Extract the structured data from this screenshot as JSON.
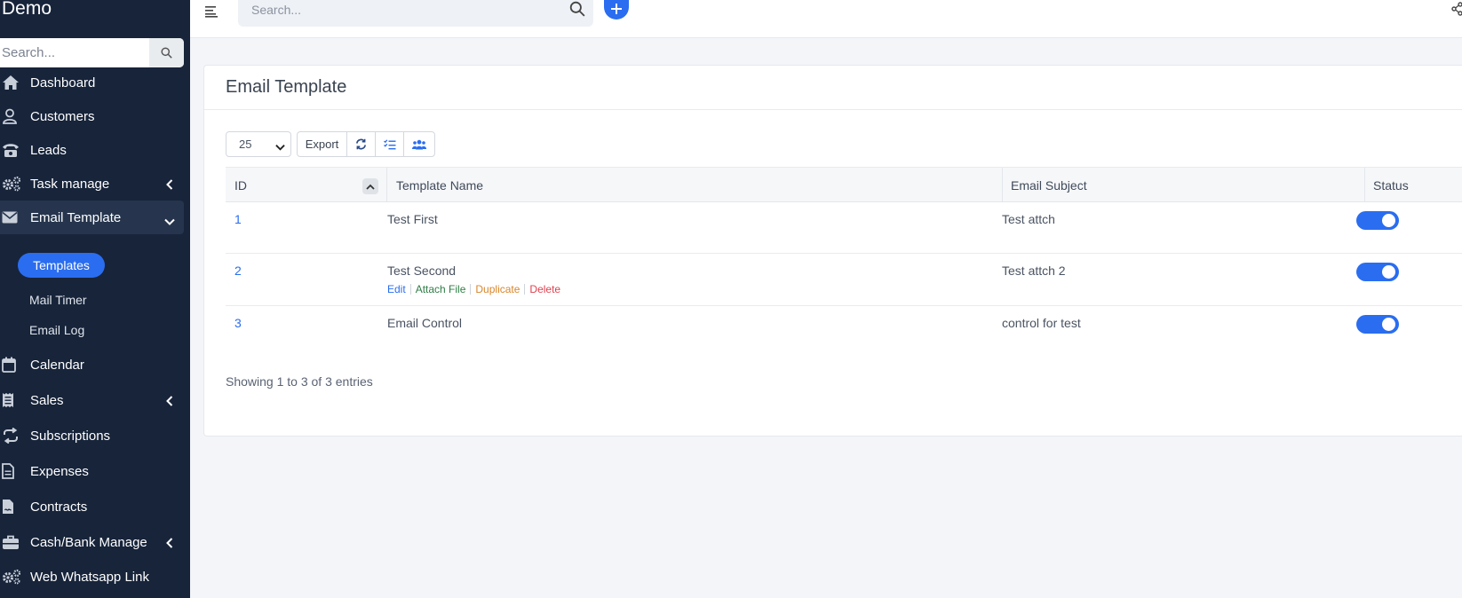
{
  "app": {
    "brand": "Demo"
  },
  "sidebar": {
    "search_placeholder": "Search...",
    "items": [
      {
        "label": "Dashboard",
        "icon": "home-icon"
      },
      {
        "label": "Customers",
        "icon": "user-icon"
      },
      {
        "label": "Leads",
        "icon": "phone-icon"
      },
      {
        "label": "Task manage",
        "icon": "gears-icon"
      },
      {
        "label": "Email Template",
        "icon": "envelope-icon"
      },
      {
        "label": "Calendar",
        "icon": "calendar-icon"
      },
      {
        "label": "Sales",
        "icon": "receipt-icon"
      },
      {
        "label": "Subscriptions",
        "icon": "repeat-icon"
      },
      {
        "label": "Expenses",
        "icon": "file-icon"
      },
      {
        "label": "Contracts",
        "icon": "contract-icon"
      },
      {
        "label": "Cash/Bank Manage",
        "icon": "briefcase-icon"
      },
      {
        "label": "Web Whatsapp Link",
        "icon": "gears-icon"
      }
    ],
    "sub_items": [
      {
        "label": "Templates"
      },
      {
        "label": "Mail Timer"
      },
      {
        "label": "Email Log"
      }
    ]
  },
  "topbar": {
    "search_placeholder": "Search..."
  },
  "page": {
    "title": "Email Template",
    "page_size": "25",
    "export_label": "Export",
    "columns": [
      "ID",
      "Template Name",
      "Email Subject",
      "Status"
    ],
    "rows": [
      {
        "id": "1",
        "name": "Test First",
        "subject": "Test attch",
        "status": "on"
      },
      {
        "id": "2",
        "name": "Test Second",
        "subject": "Test attch 2",
        "status": "on"
      },
      {
        "id": "3",
        "name": "Email Control",
        "subject": "control for test",
        "status": "on"
      }
    ],
    "row_actions": [
      "Edit",
      "Attach File",
      "Duplicate",
      "Delete"
    ],
    "footer": "Showing 1 to 3 of 3 entries"
  },
  "colors": {
    "accent": "#2a6df0",
    "sidebar": "#17243a",
    "attach": "#2f7d46",
    "duplicate": "#d9862b",
    "delete": "#e0414f"
  }
}
